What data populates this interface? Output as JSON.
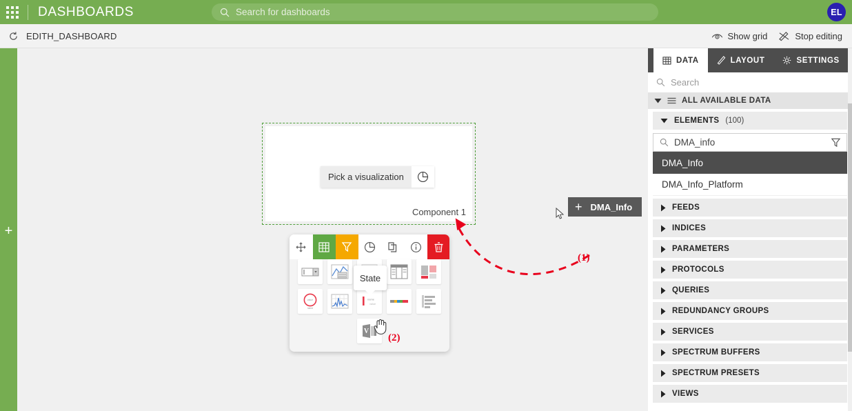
{
  "topbar": {
    "waffle_icon": "app-grid-icon",
    "title": "DASHBOARDS",
    "search_placeholder": "Search for dashboards",
    "search_value": "",
    "search_icon": "search-icon",
    "avatar_initials": "EL",
    "avatar_color": "#2a1fb0",
    "background_color": "#76ad51"
  },
  "subbar": {
    "refresh_icon": "refresh-icon",
    "dashboard_name": "EDITH_DASHBOARD",
    "show_grid_label": "Show grid",
    "show_grid_icon": "eye-icon",
    "stop_editing_label": "Stop editing",
    "stop_editing_icon": "pen-crossed-icon"
  },
  "rail": {
    "add_label": "+",
    "icon": "plus-icon",
    "color": "#76ad51"
  },
  "canvas": {
    "component": {
      "pick_visualization_label": "Pick a visualization",
      "pick_visualization_icon": "pie-chart-icon",
      "name": "Component 1",
      "selection_border_color": "#4f9e3a"
    },
    "toolbar": {
      "items": [
        {
          "name": "move-handle-icon",
          "label": "move",
          "color": "#ffffff"
        },
        {
          "name": "table-icon",
          "label": "table",
          "color": "#5fa844"
        },
        {
          "name": "filter-icon",
          "label": "filter",
          "color": "#f5a800"
        },
        {
          "name": "pie-chart-icon",
          "label": "visualization",
          "color": "#ffffff"
        },
        {
          "name": "copy-icon",
          "label": "copy",
          "color": "#ffffff"
        },
        {
          "name": "info-icon",
          "label": "info",
          "color": "#ffffff"
        },
        {
          "name": "trash-icon",
          "label": "delete",
          "color": "#e41b23"
        }
      ]
    },
    "visualization_picker": {
      "row1": [
        "dropdown-viz-icon",
        "chart-viz-icon",
        "state-viz-icon",
        "table-viz-icon",
        "tiles-viz-icon"
      ],
      "row2": [
        "gauge-viz-icon",
        "spectrum-viz-icon",
        "state-bar-viz-icon",
        "colorbar-viz-icon",
        "barlist-viz-icon"
      ],
      "row3": [
        "visio-viz-icon"
      ],
      "tooltip_label": "State"
    },
    "drag_chip": {
      "plus": "+",
      "label": "DMA_Info"
    },
    "annotations": [
      {
        "label": "(1)",
        "color": "#e8001c"
      },
      {
        "label": "(2)",
        "color": "#e8001c"
      }
    ]
  },
  "panel": {
    "tabs": [
      {
        "label": "DATA",
        "icon": "table-icon",
        "active": true
      },
      {
        "label": "LAYOUT",
        "icon": "pen-icon",
        "active": false
      },
      {
        "label": "SETTINGS",
        "icon": "gear-icon",
        "active": false
      }
    ],
    "search_placeholder": "Search",
    "search_value": "",
    "all_available_data_label": "ALL AVAILABLE DATA",
    "elements": {
      "label": "ELEMENTS",
      "count": "(100)",
      "filter_value": "DMA_info",
      "filter_icon": "funnel-icon",
      "items": [
        {
          "name": "DMA_Info",
          "selected": true
        },
        {
          "name": "DMA_Info_Platform",
          "selected": false
        }
      ]
    },
    "sections": [
      "FEEDS",
      "INDICES",
      "PARAMETERS",
      "PROTOCOLS",
      "QUERIES",
      "REDUNDANCY GROUPS",
      "SERVICES",
      "SPECTRUM BUFFERS",
      "SPECTRUM PRESETS",
      "VIEWS"
    ]
  }
}
